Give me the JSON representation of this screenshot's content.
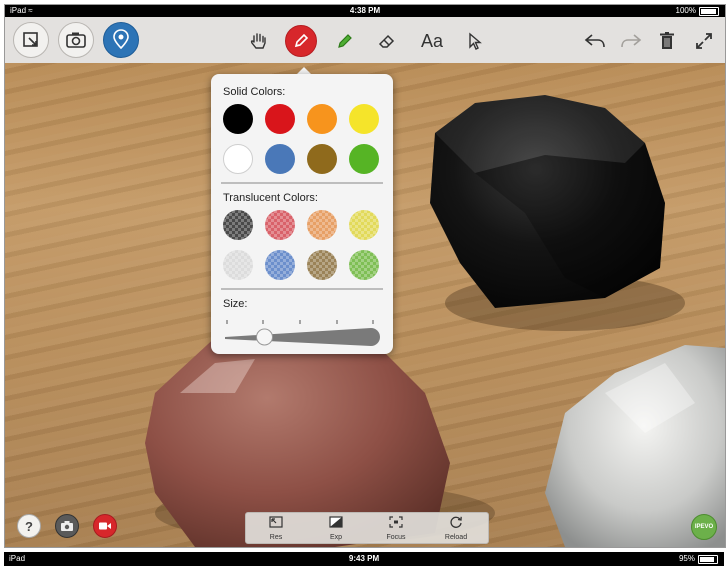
{
  "status_bar": {
    "device": "iPad",
    "wifi_icon": "wifi-icon",
    "time": "4:38 PM",
    "battery_percent": "100%",
    "battery_level": 1.0
  },
  "toolbar": {
    "left_icons": [
      "select-box-icon",
      "camera-icon",
      "location-pin-icon"
    ],
    "center_icons": [
      "hand-icon",
      "pen-icon",
      "highlighter-icon",
      "eraser-icon",
      "text-icon",
      "pointer-icon"
    ],
    "text_tool_label": "Aa",
    "right_icons": [
      "undo-icon",
      "redo-icon",
      "trash-icon",
      "expand-icon"
    ],
    "active_tool": "pen",
    "active_color": "#d7272b"
  },
  "color_picker": {
    "solid_label": "Solid Colors:",
    "solid_colors": [
      "#000000",
      "#d9151b",
      "#f7941d",
      "#f5e42a",
      "#ffffff",
      "#4a78b8",
      "#8f6a1c",
      "#56b425"
    ],
    "translucent_label": "Translucent Colors:",
    "translucent_colors": [
      "#4a4a4a",
      "#d9626a",
      "#e7a066",
      "#e2da5a",
      "#dcdcdc",
      "#6c8fcc",
      "#9b8358",
      "#7fbf55"
    ],
    "size_label": "Size:",
    "size_value": 0.25
  },
  "bottom_left": {
    "icons": [
      "help-icon",
      "snapshot-icon",
      "record-icon"
    ],
    "help_label": "?"
  },
  "camera_controls": [
    {
      "label": "Res",
      "icon": "resolution-icon"
    },
    {
      "label": "Exp",
      "icon": "exposure-icon"
    },
    {
      "label": "Focus",
      "icon": "focus-icon"
    },
    {
      "label": "Reload",
      "icon": "reload-icon"
    }
  ],
  "brand_badge": "IPEVO",
  "status_bar_2": {
    "device": "iPad",
    "time": "9:43 PM",
    "battery_percent": "95%",
    "battery_level": 0.95
  }
}
